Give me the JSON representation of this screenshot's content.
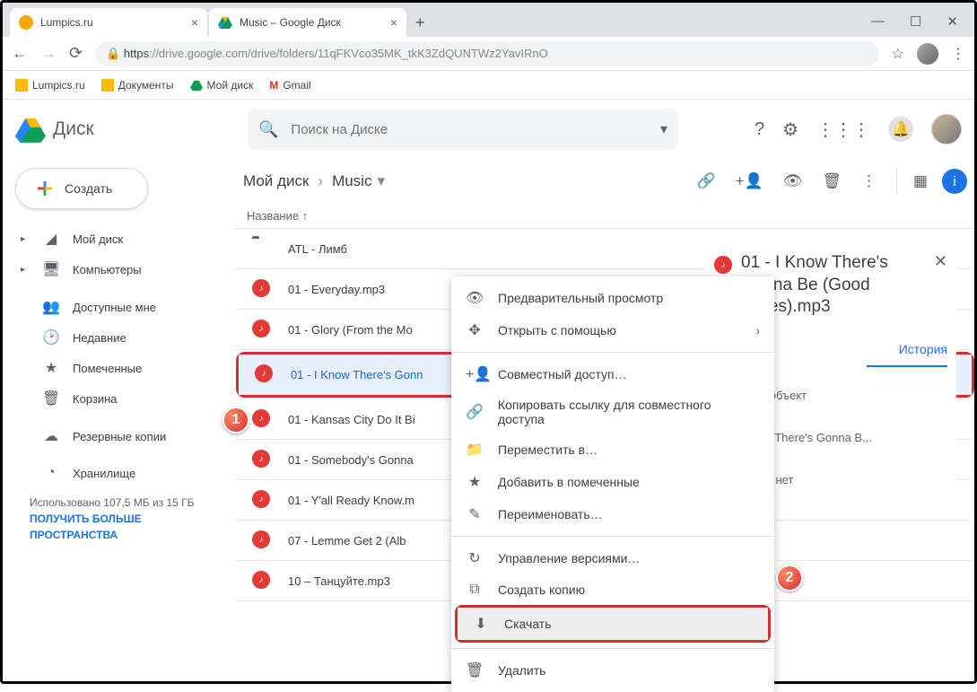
{
  "window": {
    "min": "—",
    "max": "☐",
    "close": "✕"
  },
  "tabs": [
    {
      "title": "Lumpics.ru",
      "fav": "#ffa500"
    },
    {
      "title": "Music – Google Диск",
      "fav": "drive"
    }
  ],
  "url": {
    "https": "https",
    "rest": "://drive.google.com/drive/folders/11qFKVco35MK_tkK3ZdQUNТWz2YavIRnO"
  },
  "bookmarks": [
    {
      "label": "Lumpics.ru",
      "color": "#fbbc04"
    },
    {
      "label": "Документы",
      "color": "#fbbc04"
    },
    {
      "label": "Мой диск",
      "color": "drive"
    },
    {
      "label": "Gmail",
      "color": "gmail"
    }
  ],
  "app": {
    "name": "Диск"
  },
  "search": {
    "placeholder": "Поиск на Диске"
  },
  "create": {
    "label": "Создать"
  },
  "nav": [
    {
      "label": "Мой диск",
      "icon": "▲",
      "expand": true
    },
    {
      "label": "Компьютеры",
      "icon": "⬛",
      "expand": true
    },
    {
      "label": "Доступные мне",
      "icon": "👥"
    },
    {
      "label": "Недавние",
      "icon": "🕑"
    },
    {
      "label": "Помеченные",
      "icon": "★"
    },
    {
      "label": "Корзина",
      "icon": "🗑"
    },
    {
      "label": "Резервные копии",
      "icon": "☁"
    }
  ],
  "storage": {
    "title": "Хранилище",
    "usage": "Использовано 107,5 МБ из 15 ГБ",
    "link": "ПОЛУЧИТЬ БОЛЬШЕ ПРОСТРАНСТВА"
  },
  "breadcrumb": {
    "root": "Мой диск",
    "current": "Music"
  },
  "colheader": "Название",
  "files": [
    {
      "name": "ATL - Лимб",
      "type": "folder"
    },
    {
      "name": "01 - Everyday.mp3",
      "type": "audio"
    },
    {
      "name": "01 - Glory (From the Mo",
      "type": "audio"
    },
    {
      "name": "01 - I Know There's Gonn",
      "type": "audio",
      "selected": true
    },
    {
      "name": "01 - Kansas City Do It Bi",
      "type": "audio"
    },
    {
      "name": "01 - Somebody's Gonna",
      "type": "audio"
    },
    {
      "name": "01 - Y'all Ready Know.m",
      "type": "audio"
    },
    {
      "name": "07 - Lemme Get 2 (Alb",
      "type": "audio"
    },
    {
      "name": "10 – Танцуйте.mp3",
      "type": "audio"
    }
  ],
  "context": [
    {
      "label": "Предварительный просмотр",
      "icon": "👁"
    },
    {
      "label": "Открыть с помощью",
      "icon": "✥",
      "arrow": true
    },
    {
      "divider": true
    },
    {
      "label": "Совместный доступ…",
      "icon": "+👤"
    },
    {
      "label": "Копировать ссылку для совместного доступа",
      "icon": "🔗"
    },
    {
      "label": "Переместить в…",
      "icon": "📁"
    },
    {
      "label": "Добавить в помеченные",
      "icon": "★"
    },
    {
      "label": "Переименовать…",
      "icon": "✎"
    },
    {
      "divider": true
    },
    {
      "label": "Управление версиями…",
      "icon": "↻"
    },
    {
      "label": "Создать копию",
      "icon": "⧉"
    },
    {
      "label": "Скачать",
      "icon": "⬇",
      "highlight": true
    },
    {
      "divider": true
    },
    {
      "label": "Удалить",
      "icon": "🗑"
    }
  ],
  "details": {
    "title": "01 - I Know There's Gonna Be (Good Times).mp3",
    "tab": "История",
    "line1": "и 1 объект",
    "line2": "now There's Gonna B...",
    "line3": "18 г. нет"
  }
}
